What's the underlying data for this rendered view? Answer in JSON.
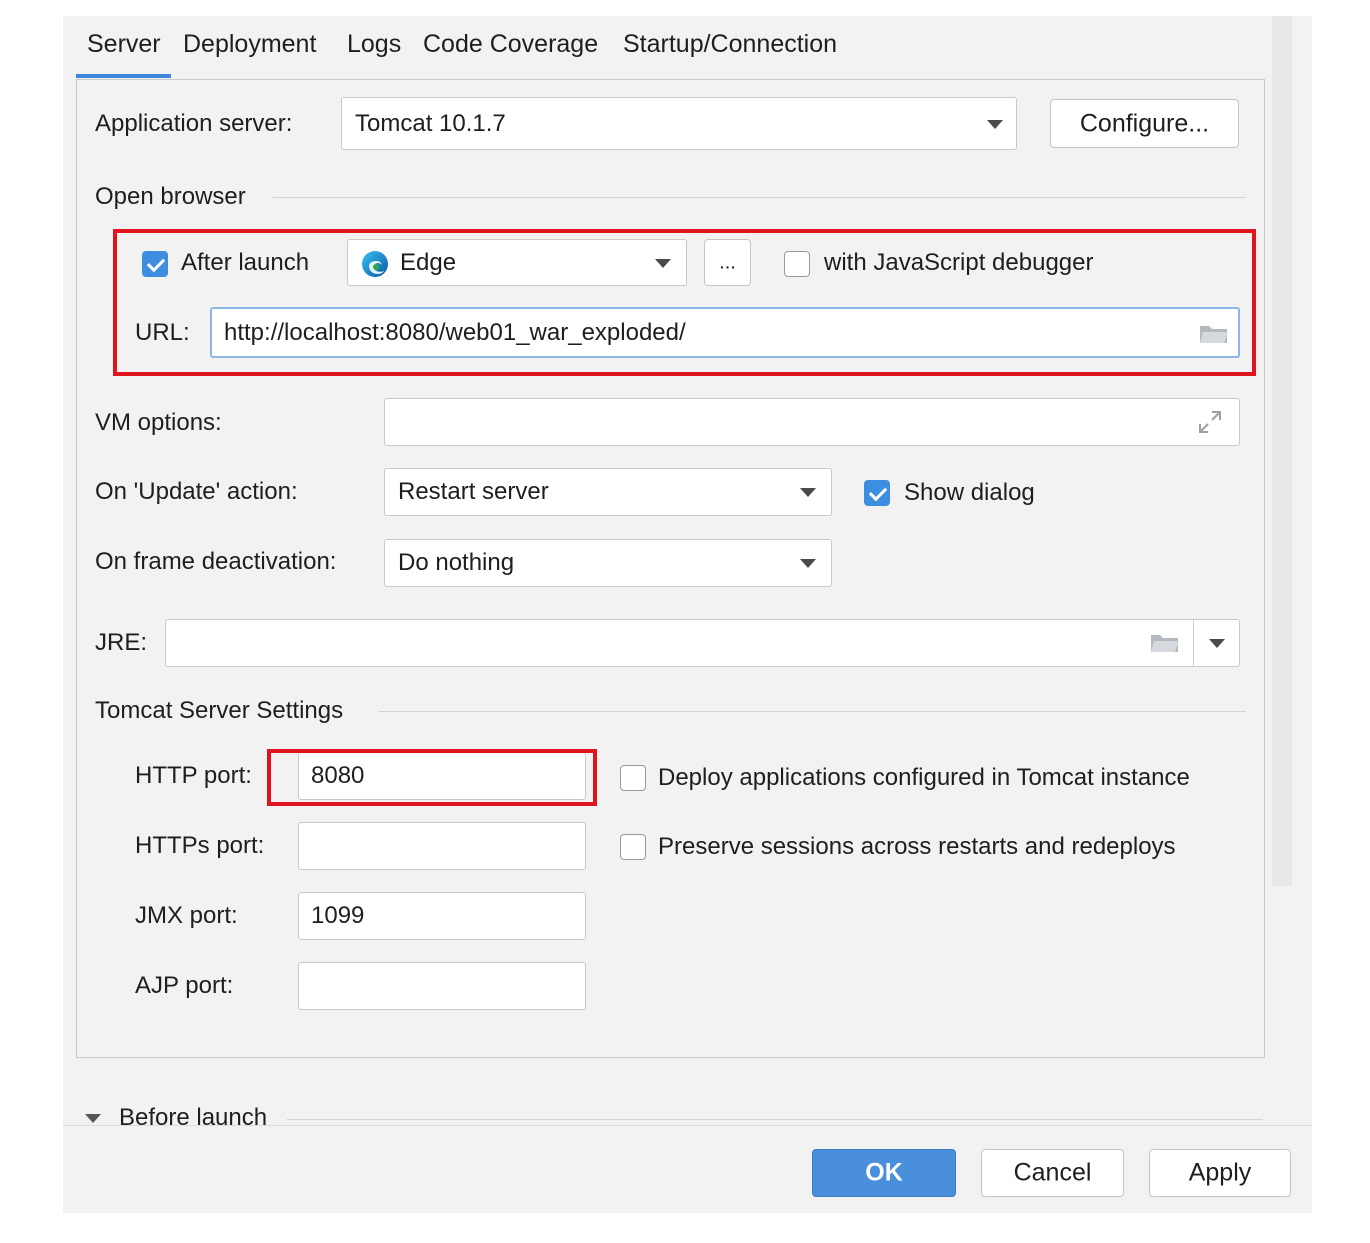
{
  "tabs": [
    "Server",
    "Deployment",
    "Logs",
    "Code Coverage",
    "Startup/Connection"
  ],
  "app_server": {
    "label": "Application server:",
    "value": "Tomcat 10.1.7",
    "configure_label": "Configure..."
  },
  "open_browser": {
    "section_label": "Open browser",
    "after_launch_label": "After launch",
    "after_launch_checked": true,
    "browser": "Edge",
    "more_label": "...",
    "js_debugger_label": "with JavaScript debugger",
    "js_debugger_checked": false,
    "url_label": "URL:",
    "url_value": "http://localhost:8080/web01_war_exploded/"
  },
  "vm_options": {
    "label": "VM options:",
    "value": ""
  },
  "on_update": {
    "label": "On 'Update' action:",
    "value": "Restart server",
    "show_dialog_label": "Show dialog",
    "show_dialog_checked": true
  },
  "on_frame": {
    "label": "On frame deactivation:",
    "value": "Do nothing"
  },
  "jre": {
    "label": "JRE:",
    "value": ""
  },
  "tomcat": {
    "section_label": "Tomcat Server Settings",
    "http_label": "HTTP port:",
    "http_value": "8080",
    "https_label": "HTTPs port:",
    "https_value": "",
    "jmx_label": "JMX port:",
    "jmx_value": "1099",
    "ajp_label": "AJP port:",
    "ajp_value": "",
    "deploy_label": "Deploy applications configured in Tomcat instance",
    "deploy_checked": false,
    "preserve_label": "Preserve sessions across restarts and redeploys",
    "preserve_checked": false
  },
  "before_launch": {
    "label": "Before launch"
  },
  "footer": {
    "ok_label": "OK",
    "cancel_label": "Cancel",
    "apply_label": "Apply"
  },
  "colors": {
    "accent": "#3d8ee0",
    "highlight": "#e0141e",
    "primary_button": "#4a8fdb"
  }
}
